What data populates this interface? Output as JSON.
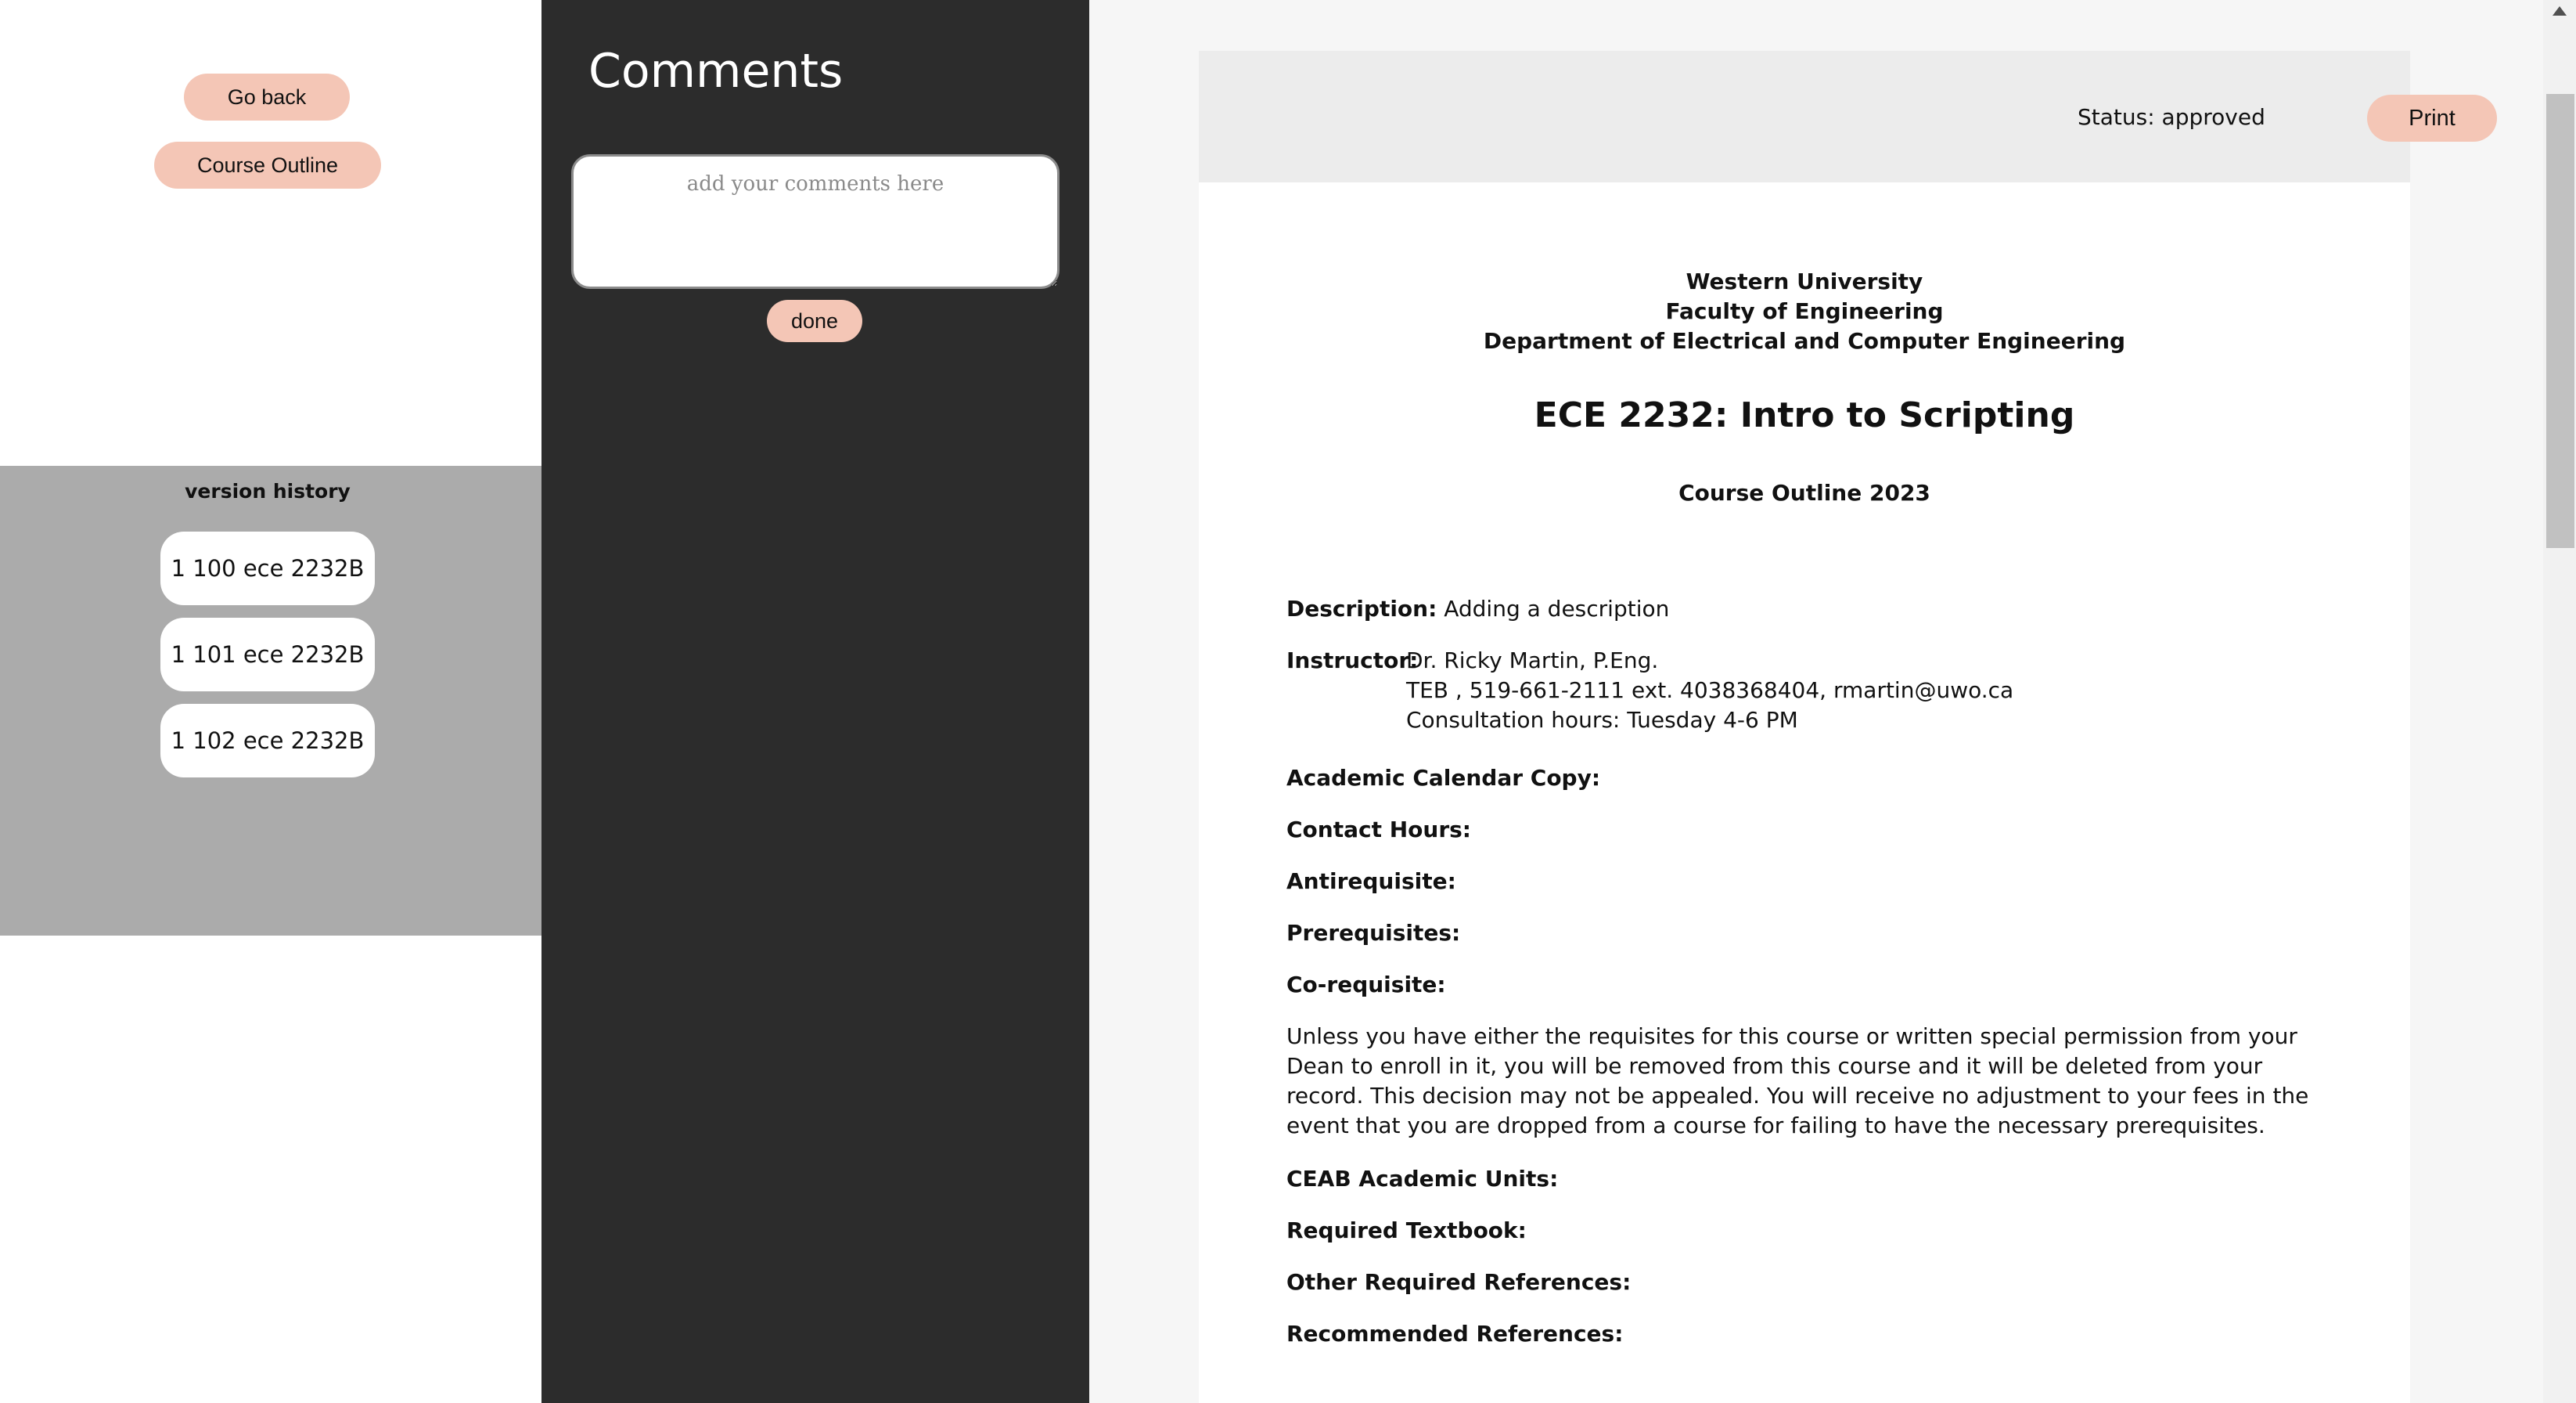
{
  "nav": {
    "go_back_label": "Go back",
    "course_outline_label": "Course Outline"
  },
  "version_history": {
    "title": "version history",
    "items": [
      "1 100 ece 2232B",
      "1 101 ece 2232B",
      "1 102 ece 2232B"
    ]
  },
  "comments": {
    "title": "Comments",
    "placeholder": "add your comments here",
    "done_label": "done"
  },
  "doc_header": {
    "status": "Status: approved",
    "print_label": "Print"
  },
  "document": {
    "university": "Western University",
    "faculty": "Faculty of Engineering",
    "department": "Department of Electrical and Computer Engineering",
    "course_title": "ECE 2232: Intro to Scripting",
    "outline_year": "Course Outline 2023",
    "description_label": "Description:",
    "description_value": "Adding a description",
    "instructor_label": "Instructor:",
    "instructor_name": "Dr. Ricky Martin, P.Eng.",
    "instructor_contact": "TEB , 519-661-2111 ext. 4038368404, rmartin@uwo.ca",
    "instructor_hours": "Consultation hours: Tuesday 4-6 PM",
    "academic_calendar_label": "Academic Calendar Copy:",
    "contact_hours_label": "Contact Hours:",
    "antirequisite_label": "Antirequisite:",
    "prerequisites_label": "Prerequisites:",
    "corequisite_label": "Co-requisite:",
    "requisite_notice": "Unless you have either the requisites for this course or written special permission from your Dean to enroll in it, you will be removed from this course and it will be deleted from your record. This decision may not be appealed. You will receive no adjustment to your fees in the event that you are dropped from a course for failing to have the necessary prerequisites.",
    "ceab_label": "CEAB Academic Units:",
    "required_textbook_label": "Required Textbook:",
    "other_references_label": "Other Required References:",
    "recommended_references_label": "Recommended References:"
  },
  "colors": {
    "accent_button": "#f4c6b6",
    "comments_bg": "#2c2c2c",
    "version_panel_bg": "#ababab"
  }
}
